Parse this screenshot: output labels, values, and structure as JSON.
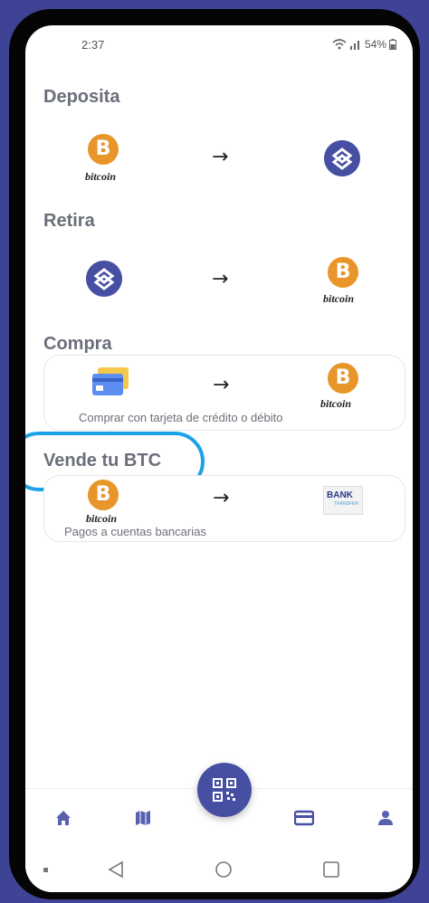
{
  "status_bar": {
    "time": "2:37",
    "battery": "54%"
  },
  "sections": {
    "deposita": {
      "title": "Deposita"
    },
    "retira": {
      "title": "Retira"
    },
    "compra": {
      "title": "Compra",
      "caption": "Comprar con tarjeta de crédito o débito"
    },
    "vende": {
      "title": "Vende tu BTC",
      "caption": "Pagos a cuentas bancarias"
    }
  },
  "labels": {
    "bitcoin": "bitcoin",
    "arrow": "→",
    "bitcoin_symbol": "B",
    "bank_top": "BANK",
    "bank_bottom": "TRANSFER"
  },
  "bottom_nav": {
    "items": [
      "home",
      "map",
      "scan",
      "card",
      "profile"
    ],
    "active": "card"
  },
  "colors": {
    "accent": "#474fa3",
    "bitcoin": "#e8952a",
    "highlight": "#1aa3e8",
    "background": "#3f4395"
  },
  "icons": [
    "home-icon",
    "map-icon",
    "qr-scan-icon",
    "credit-card-icon",
    "user-icon",
    "back-icon",
    "home-circle-icon",
    "recents-icon"
  ]
}
